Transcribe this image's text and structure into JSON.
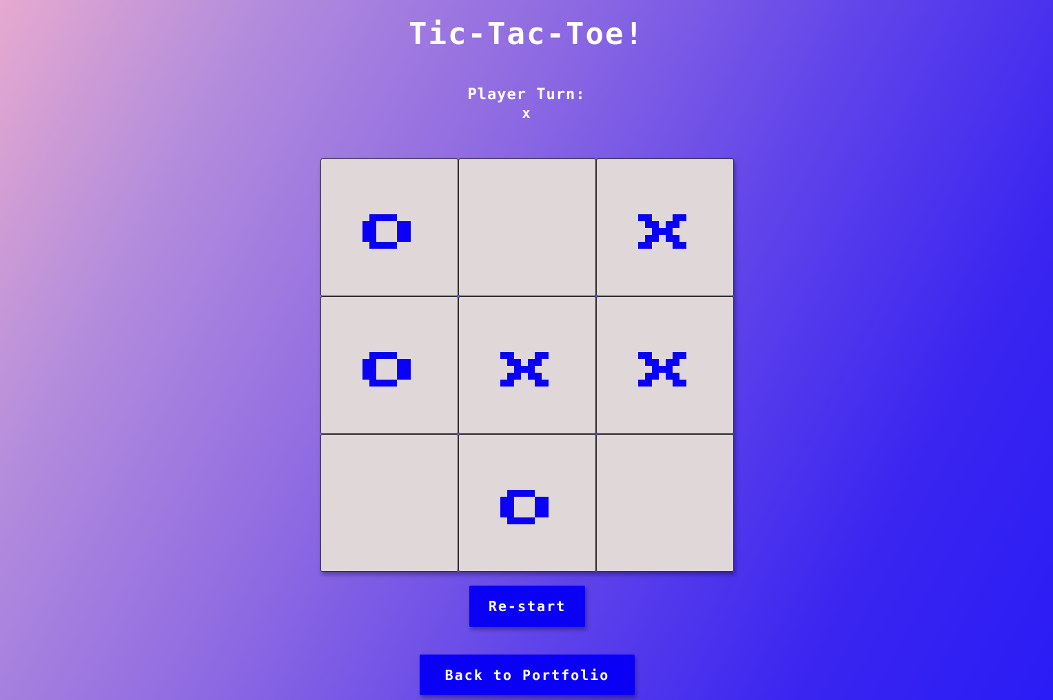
{
  "header": {
    "title": "Tic-Tac-Toe!"
  },
  "status": {
    "label": "Player Turn:",
    "current_player": "x"
  },
  "board": {
    "cells": [
      "o",
      "",
      "x",
      "o",
      "x",
      "x",
      "",
      "o",
      ""
    ],
    "mark_color": "#0a00f5",
    "cell_color": "#e0d8d8"
  },
  "buttons": {
    "restart_label": "Re-start",
    "back_label": "Back to Portfolio"
  },
  "colors": {
    "button_bg": "#0a00f5",
    "text": "#ffffff"
  }
}
